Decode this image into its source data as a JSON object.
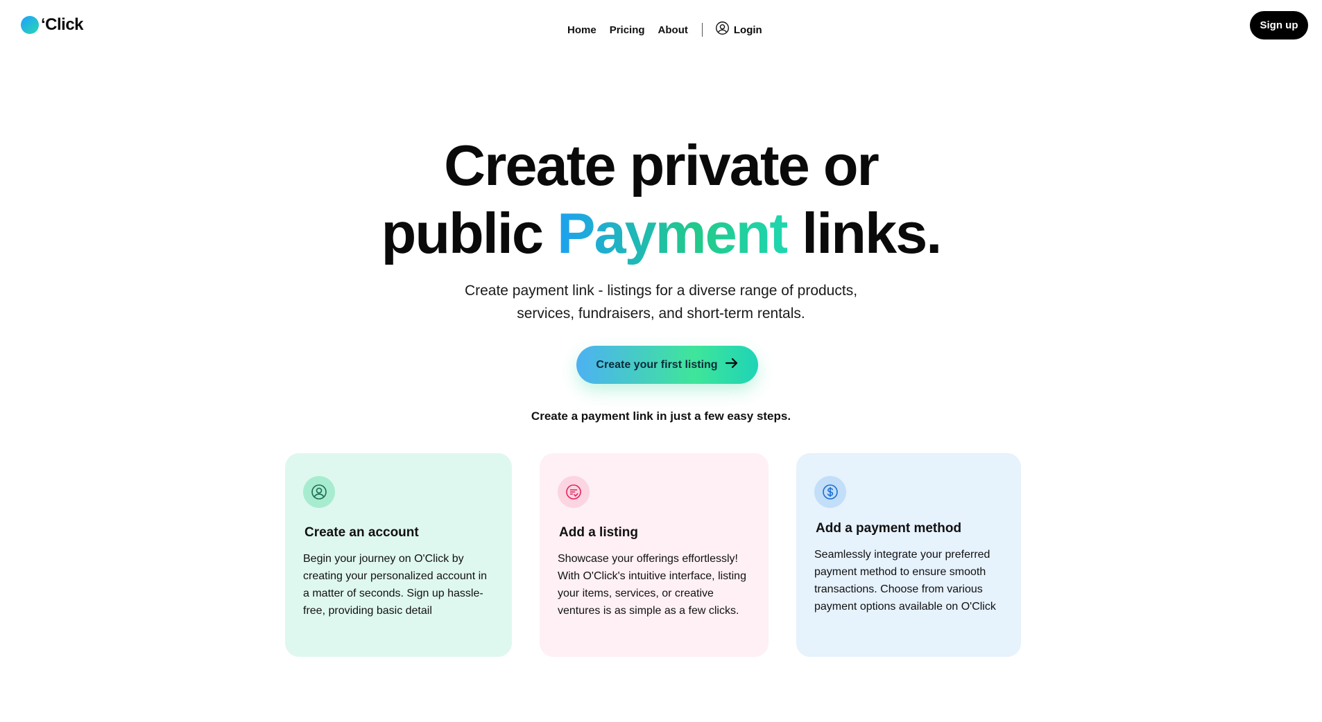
{
  "brand": {
    "logo_text": "‘Click"
  },
  "nav": {
    "home": "Home",
    "pricing": "Pricing",
    "about": "About",
    "login": "Login",
    "signup": "Sign up"
  },
  "hero": {
    "title_line1": "Create private or",
    "title_line2_pre": "public",
    "title_highlight": "Payment",
    "title_line2_post": "links.",
    "subtitle_line1": "Create payment link - listings for a diverse range of products,",
    "subtitle_line2": "services, fundraisers, and short-term rentals.",
    "cta_label": "Create your first listing",
    "steps_caption": "Create a payment link in just a few easy steps."
  },
  "cards": [
    {
      "icon": "user-circle-icon",
      "title": "Create an account",
      "body": "Begin your journey on O'Click by creating your personalized account in a matter of seconds. Sign up hassle-free, providing basic detail"
    },
    {
      "icon": "listing-check-icon",
      "title": "Add a listing",
      "body": "Showcase your offerings effortlessly! With O'Click's intuitive interface, listing your items, services, or creative ventures is as simple as a few clicks."
    },
    {
      "icon": "dollar-circle-icon",
      "title": "Add a payment method",
      "body": "Seamlessly integrate your preferred payment method to ensure smooth transactions. Choose from various payment options available on O'Click"
    }
  ],
  "colors": {
    "accent_blue": "#1ea1f0",
    "accent_green": "#22c98a",
    "card1_bg": "#dff8ef",
    "card2_bg": "#fef0f4",
    "card3_bg": "#e6f2fc"
  }
}
